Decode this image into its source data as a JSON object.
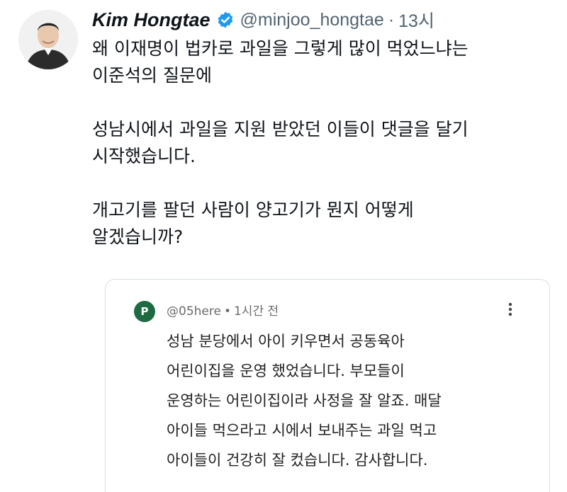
{
  "tweet": {
    "author": {
      "display_name": "Kim Hongtae",
      "handle": "@minjoo_hongtae",
      "separator": "·",
      "time": "13시"
    },
    "icons": {
      "verified": "verified-badge-icon",
      "avatar": "profile-photo"
    },
    "paragraphs": [
      [
        "왜 이재명이 법카로 과일을 그렇게 많이 먹었느냐는",
        "이준석의 질문에"
      ],
      [
        "성남시에서 과일을 지원 받았던 이들이 댓글을 달기",
        "시작했습니다."
      ],
      [
        "개고기를 팔던 사람이 양고기가 뭔지 어떻게",
        "알겠습니까?"
      ]
    ]
  },
  "quoted_comment": {
    "avatar_letter": "P",
    "username": "@05here",
    "separator": "•",
    "time": "1시간 전",
    "menu_icon": "more-vertical-icon",
    "lines": [
      "성남 분당에서 아이 키우면서 공동육아",
      "어린이집을 운영 했었습니다. 부모들이",
      "운영하는 어린이집이라 사정을 잘 알죠. 매달",
      "아이들 먹으라고 시에서 보내주는 과일 먹고",
      "아이들이 건강히 잘 컸습니다. 감사합니다."
    ]
  },
  "colors": {
    "verified_blue": "#1d9bf0",
    "comment_avatar_bg": "#1e6b43",
    "muted_text": "#536471"
  }
}
